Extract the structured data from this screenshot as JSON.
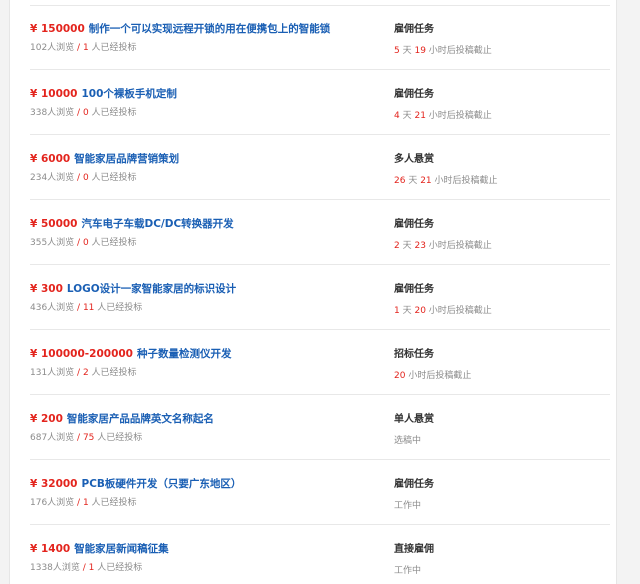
{
  "tasks": [
    {
      "price": "¥ 150000",
      "title": "制作一个可以实现远程开锁的用在便携包上的智能锁",
      "views": "102人浏览",
      "sep": " / ",
      "bids": "1",
      "bids_suffix": " 人已经投标",
      "type": "雇佣任务",
      "status": {
        "days": "5",
        "days_unit": " 天 ",
        "hours": "19",
        "suffix": " 小时后投稿截止",
        "text": ""
      }
    },
    {
      "price": "¥ 10000",
      "title": "100个裸板手机定制",
      "views": "338人浏览",
      "sep": " / ",
      "bids": "0",
      "bids_suffix": " 人已经投标",
      "type": "雇佣任务",
      "status": {
        "days": "4",
        "days_unit": " 天 ",
        "hours": "21",
        "suffix": " 小时后投稿截止",
        "text": ""
      }
    },
    {
      "price": "¥ 6000",
      "title": "智能家居品牌营销策划",
      "views": "234人浏览",
      "sep": " / ",
      "bids": "0",
      "bids_suffix": " 人已经投标",
      "type": "多人悬赏",
      "status": {
        "days": "26",
        "days_unit": " 天 ",
        "hours": "21",
        "suffix": " 小时后投稿截止",
        "text": ""
      }
    },
    {
      "price": "¥ 50000",
      "title": "汽车电子车载DC/DC转换器开发",
      "views": "355人浏览",
      "sep": " / ",
      "bids": "0",
      "bids_suffix": " 人已经投标",
      "type": "雇佣任务",
      "status": {
        "days": "2",
        "days_unit": " 天 ",
        "hours": "23",
        "suffix": " 小时后投稿截止",
        "text": ""
      }
    },
    {
      "price": "¥ 300",
      "title": "LOGO设计一家智能家居的标识设计",
      "views": "436人浏览",
      "sep": " / ",
      "bids": "11",
      "bids_suffix": " 人已经投标",
      "type": "雇佣任务",
      "status": {
        "days": "1",
        "days_unit": " 天 ",
        "hours": "20",
        "suffix": " 小时后投稿截止",
        "text": ""
      }
    },
    {
      "price": "¥ 100000-200000",
      "title": "种子数量检测仪开发",
      "views": "131人浏览",
      "sep": " / ",
      "bids": "2",
      "bids_suffix": " 人已经投标",
      "type": "招标任务",
      "status": {
        "days": "",
        "days_unit": "",
        "hours": "20",
        "suffix": " 小时后投稿截止",
        "text": ""
      }
    },
    {
      "price": "¥ 200",
      "title": "智能家居产品品牌英文名称起名",
      "views": "687人浏览",
      "sep": " / ",
      "bids": "75",
      "bids_suffix": " 人已经投标",
      "type": "单人悬赏",
      "status": {
        "days": "",
        "days_unit": "",
        "hours": "",
        "suffix": "",
        "text": "选稿中"
      }
    },
    {
      "price": "¥ 32000",
      "title": "PCB板硬件开发（只要广东地区）",
      "views": "176人浏览",
      "sep": " / ",
      "bids": "1",
      "bids_suffix": " 人已经投标",
      "type": "雇佣任务",
      "status": {
        "days": "",
        "days_unit": "",
        "hours": "",
        "suffix": "",
        "text": "工作中"
      }
    },
    {
      "price": "¥ 1400",
      "title": "智能家居新闻稿征集",
      "views": "1338人浏览",
      "sep": " / ",
      "bids": "1",
      "bids_suffix": " 人已经投标",
      "type": "直接雇佣",
      "status": {
        "days": "",
        "days_unit": "",
        "hours": "",
        "suffix": "",
        "text": "工作中"
      }
    }
  ]
}
